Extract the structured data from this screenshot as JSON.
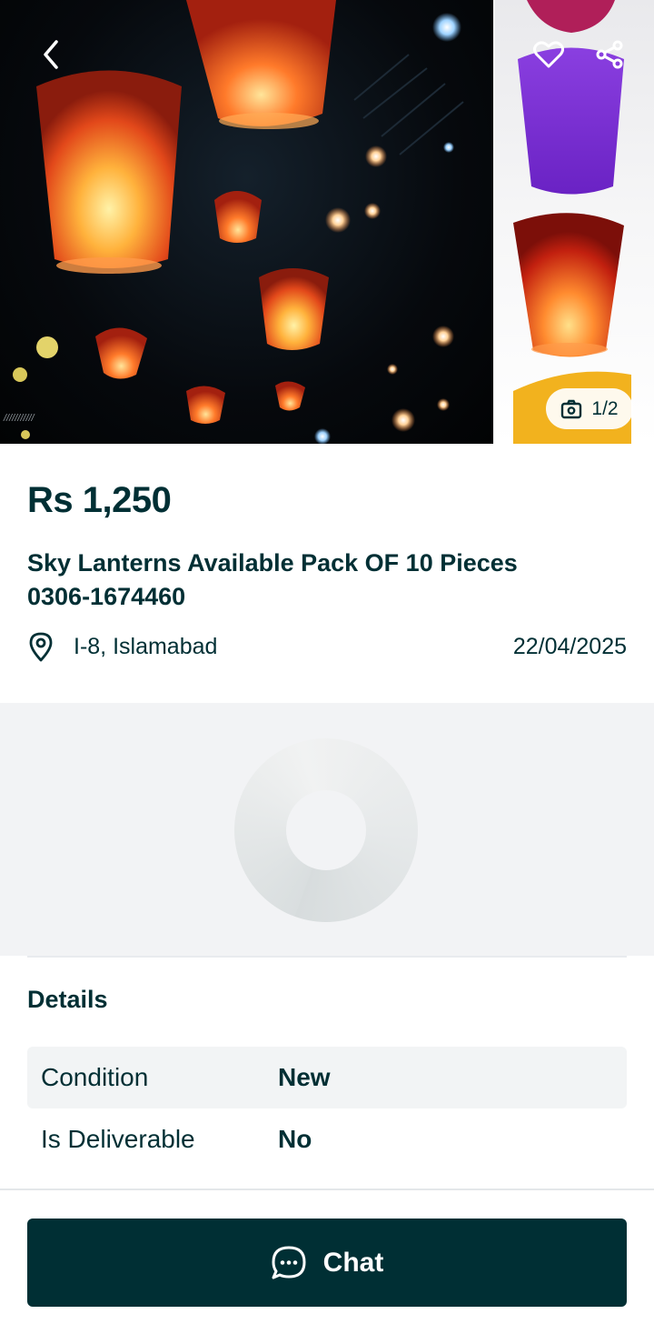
{
  "gallery": {
    "counter": "1/2",
    "image_description_icon": "camera-icon"
  },
  "listing": {
    "price": "Rs 1,250",
    "title_line1": "Sky Lanterns Available Pack OF 10 Pieces",
    "title_line2": "0306-1674460",
    "location": "I-8, Islamabad",
    "date": "22/04/2025"
  },
  "details": {
    "heading": "Details",
    "rows": [
      {
        "label": "Condition",
        "value": "New"
      },
      {
        "label": "Is Deliverable",
        "value": "No"
      }
    ]
  },
  "footer": {
    "chat_label": "Chat"
  },
  "colors": {
    "brand_dark": "#002f34",
    "panel_gray": "#f2f3f5"
  }
}
